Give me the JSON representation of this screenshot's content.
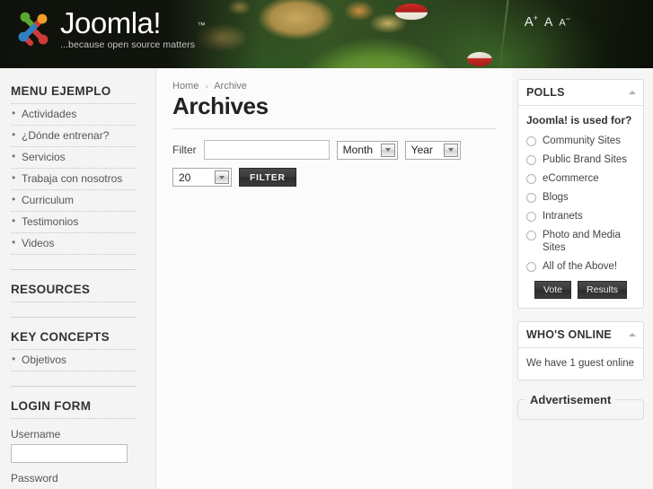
{
  "header": {
    "logo_title": "Joomla!",
    "logo_tm": "™",
    "logo_tagline": "...because open source matters",
    "font_bigger": "A",
    "font_bigger_sup": "+",
    "font_reset": "A",
    "font_smaller": "A",
    "font_smaller_sup": "−"
  },
  "sidebar_left": {
    "menu_module": {
      "title": "MENU EJEMPLO",
      "items": [
        {
          "label": "Actividades"
        },
        {
          "label": "¿Dónde entrenar?"
        },
        {
          "label": "Servicios"
        },
        {
          "label": "Trabaja con nosotros"
        },
        {
          "label": "Curriculum"
        },
        {
          "label": "Testimonios"
        },
        {
          "label": "Videos"
        }
      ]
    },
    "resources_module": {
      "title": "RESOURCES"
    },
    "key_concepts_module": {
      "title": "KEY CONCEPTS",
      "items": [
        {
          "label": "Objetivos"
        }
      ]
    },
    "login_module": {
      "title": "LOGIN FORM",
      "username_label": "Username",
      "username_value": "",
      "password_label": "Password"
    }
  },
  "main": {
    "breadcrumb": {
      "home": "Home",
      "separator": "›",
      "current": "Archive"
    },
    "page_title": "Archives",
    "filter": {
      "label": "Filter",
      "input_value": "",
      "month_select": "Month",
      "year_select": "Year",
      "limit_select": "20",
      "button_label": "FILTER"
    }
  },
  "sidebar_right": {
    "polls": {
      "title": "POLLS",
      "question": "Joomla! is used for?",
      "options": [
        {
          "label": "Community Sites"
        },
        {
          "label": "Public Brand Sites"
        },
        {
          "label": "eCommerce"
        },
        {
          "label": "Blogs"
        },
        {
          "label": "Intranets"
        },
        {
          "label": "Photo and Media Sites"
        },
        {
          "label": "All of the Above!"
        }
      ],
      "vote_label": "Vote",
      "results_label": "Results"
    },
    "whos_online": {
      "title": "WHO'S ONLINE",
      "text": "We have 1 guest online"
    },
    "advertisement": {
      "legend": "Advertisement"
    }
  }
}
